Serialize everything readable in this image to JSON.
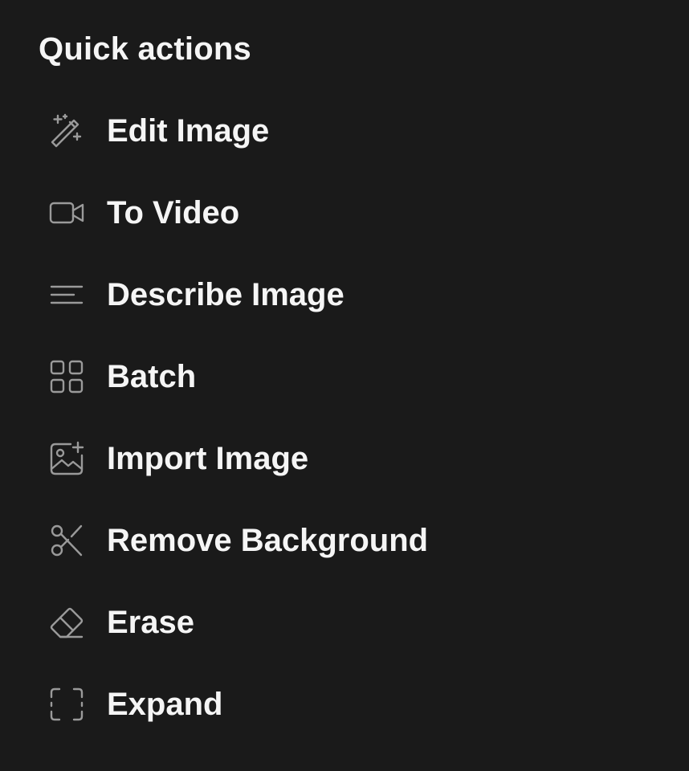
{
  "panel": {
    "title": "Quick actions"
  },
  "actions": [
    {
      "label": "Edit Image",
      "icon": "magic-wand-icon"
    },
    {
      "label": "To Video",
      "icon": "video-camera-icon"
    },
    {
      "label": "Describe Image",
      "icon": "text-lines-icon"
    },
    {
      "label": "Batch",
      "icon": "grid-icon"
    },
    {
      "label": "Import Image",
      "icon": "image-plus-icon"
    },
    {
      "label": "Remove Background",
      "icon": "scissors-icon"
    },
    {
      "label": "Erase",
      "icon": "eraser-icon"
    },
    {
      "label": "Expand",
      "icon": "expand-frame-icon"
    }
  ],
  "colors": {
    "background": "#1a1a1a",
    "text": "#f5f5f5",
    "icon": "#9a9a9a"
  }
}
